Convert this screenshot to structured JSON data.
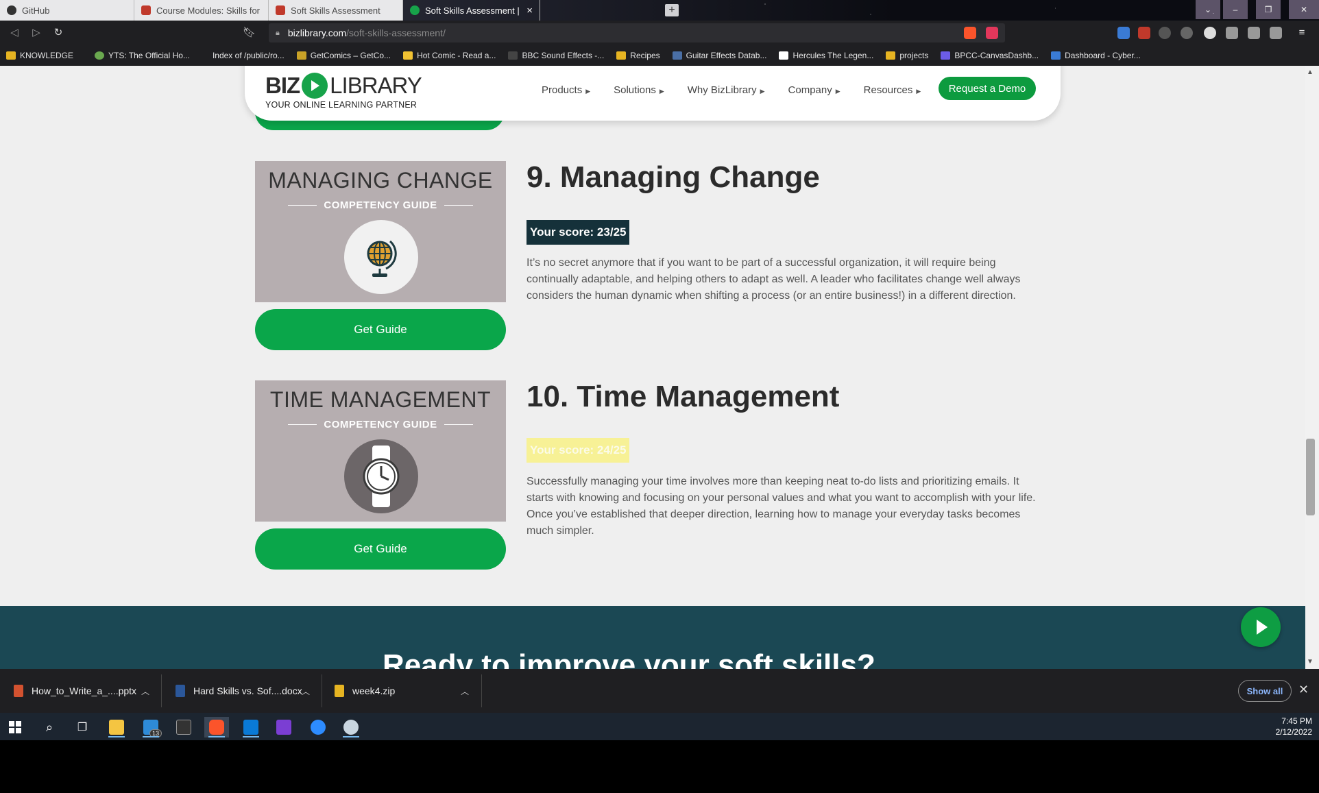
{
  "browser": {
    "tabs": [
      {
        "label": "GitHub",
        "active": false
      },
      {
        "label": "Course Modules: Skills for IT Success",
        "active": false
      },
      {
        "label": "Soft Skills Assessment",
        "active": false
      },
      {
        "label": "Soft Skills Assessment | BizLibrary",
        "active": true
      }
    ],
    "url_host": "bizlibrary.com",
    "url_path": "/soft-skills-assessment/",
    "extension_badge": "13",
    "bookmarks": [
      "KNOWLEDGE",
      "YTS: The Official Ho...",
      "Index of /public/ro...",
      "GetComics – GetCo...",
      "Hot Comic - Read a...",
      "BBC Sound Effects -...",
      "Recipes",
      "Guitar Effects Datab...",
      "Hercules The Legen...",
      "projects",
      "BPCC-CanvasDashb...",
      "Dashboard - Cyber..."
    ]
  },
  "site": {
    "logo_biz": "BIZ",
    "logo_library": "LIBRARY",
    "tagline": "YOUR ONLINE LEARNING PARTNER",
    "menu": [
      "Products",
      "Solutions",
      "Why BizLibrary",
      "Company",
      "Resources"
    ],
    "demo_button": "Request a Demo"
  },
  "sections": [
    {
      "image_title": "MANAGING CHANGE",
      "image_subtitle": "COMPETENCY GUIDE",
      "icon": "globe-icon",
      "button": "Get Guide",
      "heading": "9. Managing Change",
      "score": "Your score: 23/25",
      "description": "It’s no secret anymore that if you want to be part of a successful organization, it will require being continually adaptable, and helping others to adapt as well. A leader who facilitates change well always considers the human dynamic when shifting a process (or an entire business!) in a different direction."
    },
    {
      "image_title": "TIME MANAGEMENT",
      "image_subtitle": "COMPETENCY GUIDE",
      "icon": "watch-icon",
      "button": "Get Guide",
      "heading": "10. Time Management",
      "score": "Your score: 24/25",
      "description": "Successfully managing your time involves more than keeping neat to-do lists and prioritizing emails. It starts with knowing and focusing on your personal values and what you want to accomplish with your life. Once you’ve established that deeper direction, learning how to manage your everyday tasks becomes much simpler."
    }
  ],
  "cta": {
    "text": "Ready to improve your soft skills?"
  },
  "downloads": {
    "items": [
      "How_to_Write_a_....pptx",
      "Hard Skills vs. Sof....docx",
      "week4.zip"
    ],
    "show_all": "Show all"
  },
  "taskbar": {
    "mail_badge": "13",
    "time": "7:45 PM",
    "date": "2/12/2022"
  },
  "colors": {
    "brand_green": "#0aa64a",
    "score_dark": "#15313a",
    "score_pale": "#f7f196",
    "cta_band": "#1b4854"
  }
}
